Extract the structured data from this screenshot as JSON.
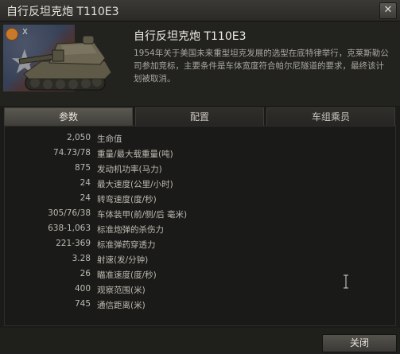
{
  "window": {
    "title": "自行反坦克炮 T110E3",
    "close_glyph": "✕"
  },
  "vehicle": {
    "tier": "X",
    "name": "自行反坦克炮 T110E3",
    "description": "1954年关于美国未来重型坦克发展的选型在底特律举行，克莱斯勒公司参加竞标，主要条件是车体宽度符合帕尔尼隧道的要求，最终该计划被取消。"
  },
  "tabs": [
    {
      "label": "参数",
      "active": true
    },
    {
      "label": "配置",
      "active": false
    },
    {
      "label": "车组乘员",
      "active": false
    }
  ],
  "stats": [
    {
      "value": "2,050",
      "label": "生命值"
    },
    {
      "value": "74.73/78",
      "label": "重量/最大载重量(吨)"
    },
    {
      "value": "875",
      "label": "发动机功率(马力)"
    },
    {
      "value": "24",
      "label": "最大速度(公里/小时)"
    },
    {
      "value": "24",
      "label": "转弯速度(度/秒)"
    },
    {
      "value": "305/76/38",
      "label": "车体装甲(前/侧/后 毫米)"
    },
    {
      "value": "638-1,063",
      "label": "标准炮弹的杀伤力"
    },
    {
      "value": "221-369",
      "label": "标准弹药穿透力"
    },
    {
      "value": "3.28",
      "label": "射速(发/分钟)"
    },
    {
      "value": "26",
      "label": "瞄准速度(度/秒)"
    },
    {
      "value": "400",
      "label": "观察范围(米)"
    },
    {
      "value": "745",
      "label": "通信距离(米)"
    }
  ],
  "footer": {
    "close_label": "关闭"
  }
}
